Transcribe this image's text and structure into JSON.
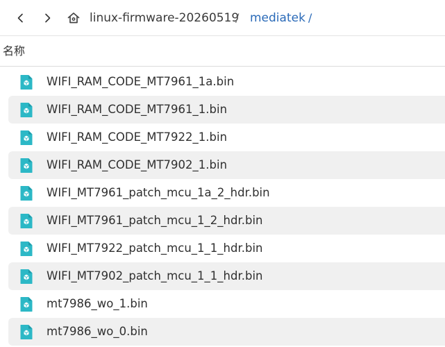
{
  "pathbar": {
    "back_icon": "chevron-left-icon",
    "forward_icon": "chevron-right-icon",
    "home_icon": "home-icon",
    "crumbs": [
      "linux-firmware-20260519",
      "mediatek"
    ],
    "separator": "/",
    "current_color": "#2a6ab8"
  },
  "columns": {
    "name": "名称"
  },
  "file_icon": "binary-file-icon",
  "file_icon_color": "#2cb8c6",
  "files": [
    "WIFI_RAM_CODE_MT7961_1a.bin",
    "WIFI_RAM_CODE_MT7961_1.bin",
    "WIFI_RAM_CODE_MT7922_1.bin",
    "WIFI_RAM_CODE_MT7902_1.bin",
    "WIFI_MT7961_patch_mcu_1a_2_hdr.bin",
    "WIFI_MT7961_patch_mcu_1_2_hdr.bin",
    "WIFI_MT7922_patch_mcu_1_1_hdr.bin",
    "WIFI_MT7902_patch_mcu_1_1_hdr.bin",
    "mt7986_wo_1.bin",
    "mt7986_wo_0.bin"
  ]
}
